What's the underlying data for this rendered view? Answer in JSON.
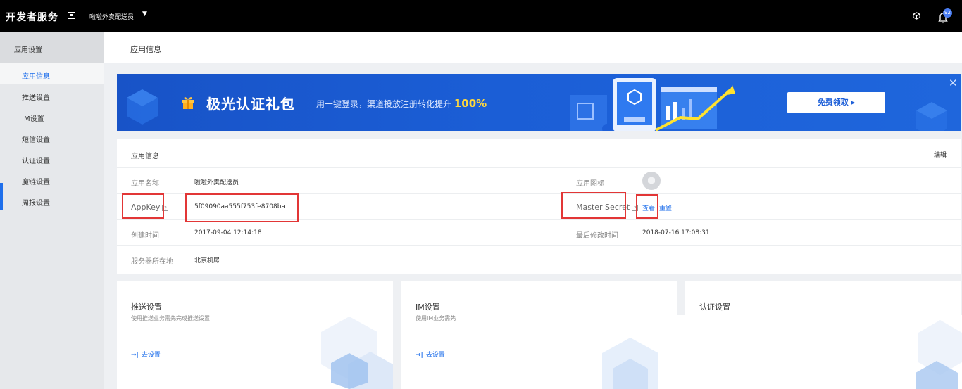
{
  "topbar": {
    "brand": "开发者服务",
    "app_name": "啦啦外卖配送员",
    "caret": "▼",
    "notification_count": "92"
  },
  "sidebar": {
    "header": "应用设置",
    "items": [
      {
        "label": "应用信息",
        "active": true
      },
      {
        "label": "推送设置"
      },
      {
        "label": "IM设置"
      },
      {
        "label": "短信设置"
      },
      {
        "label": "认证设置"
      },
      {
        "label": "魔链设置"
      },
      {
        "label": "周报设置"
      }
    ]
  },
  "page": {
    "title": "应用信息"
  },
  "banner": {
    "title": "极光认证礼包",
    "subtitle": "用一键登录，渠道投放注册转化提升",
    "highlight": "100%",
    "cta": "免费领取 ▸",
    "close": "✕"
  },
  "info": {
    "header": "应用信息",
    "edit": "编辑",
    "app_name_label": "应用名称",
    "app_name_value": "啦啦外卖配送员",
    "app_icon_label": "应用图标",
    "appkey_label": "AppKey",
    "appkey_value": "5f09090aa555f753fe8708ba",
    "master_secret_label": "Master Secret",
    "view_link": "查看",
    "reset_link": "重置",
    "created_label": "创建时间",
    "created_value": "2017-09-04 12:14:18",
    "modified_label": "最后修改时间",
    "modified_value": "2018-07-16 17:08:31",
    "server_label": "服务器所在地",
    "server_value": "北京机房",
    "help_glyph": "?"
  },
  "cards": [
    {
      "title": "推送设置",
      "desc": "使用推送业务需先完成推送设置",
      "action": "去设置"
    },
    {
      "title": "IM设置",
      "desc": "使用IM业务需先",
      "action": "去设置"
    },
    {
      "title": "认证设置",
      "desc": "",
      "action": ""
    }
  ],
  "colors": {
    "accent": "#1f6feb",
    "topbar": "#000000",
    "banner": "#1b5ed6",
    "highlight_box": "#e23636",
    "banner_highlight": "#ffd93d"
  }
}
